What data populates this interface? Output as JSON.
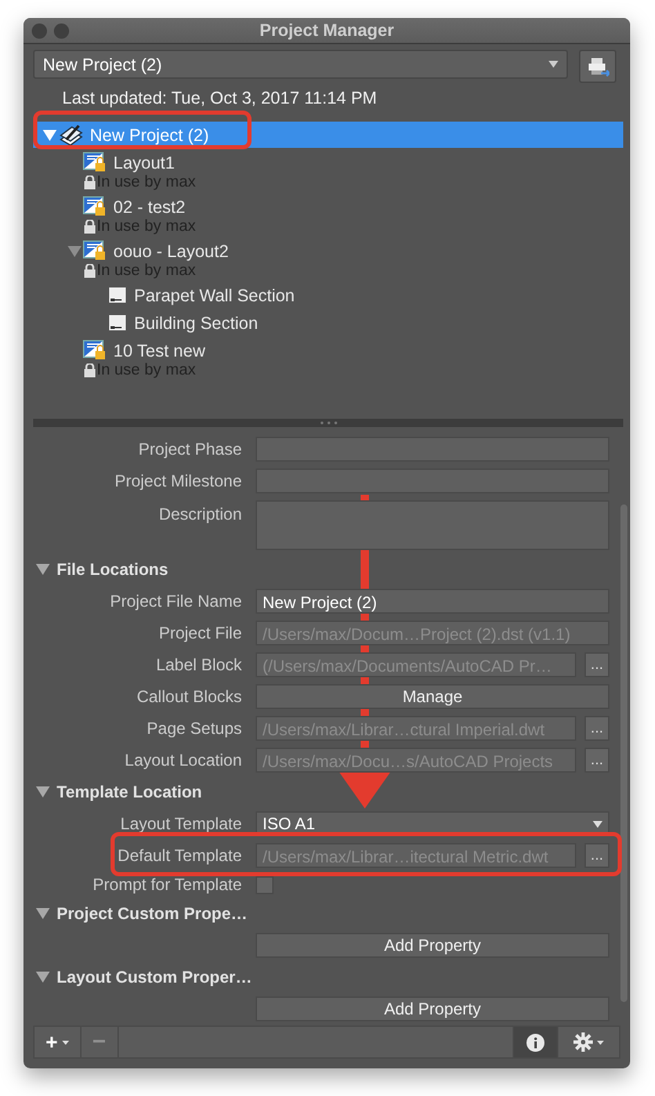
{
  "window": {
    "title": "Project Manager"
  },
  "project_select": {
    "value": "New Project (2)"
  },
  "last_updated": "Last updated: Tue, Oct 3, 2017 11:14 PM",
  "tree": [
    {
      "kind": "project",
      "label": "New Project (2)",
      "selected": true,
      "expanded": true,
      "children": [
        {
          "kind": "layout",
          "label": "Layout1",
          "status": "In use by max",
          "selected": false
        },
        {
          "kind": "layout",
          "label": "02 - test2",
          "status": "In use by max",
          "selected": false
        },
        {
          "kind": "layout",
          "label": "oouo - Layout2",
          "status": "In use by max",
          "selected": false,
          "expanded": true,
          "children": [
            {
              "kind": "view",
              "label": "Parapet Wall Section",
              "selected": false
            },
            {
              "kind": "view",
              "label": "Building Section",
              "selected": false
            }
          ]
        },
        {
          "kind": "layout",
          "label": "10 Test new",
          "status": "In use by max",
          "selected": false
        }
      ]
    }
  ],
  "properties": [
    {
      "kind": "field",
      "label": "Project Phase"
    },
    {
      "kind": "field",
      "label": "Project Milestone"
    },
    {
      "kind": "textarea",
      "label": "Description"
    },
    {
      "kind": "section",
      "label": "File Locations",
      "expanded": true
    },
    {
      "kind": "field",
      "label": "Project File Name",
      "value": "New Project (2)"
    },
    {
      "kind": "path",
      "label": "Project File",
      "value": "/Users/max/Docum…Project (2).dst (v1.1)"
    },
    {
      "kind": "browse",
      "label": "Label Block",
      "value": "(/Users/max/Documents/AutoCAD Pr…",
      "button": "..."
    },
    {
      "kind": "button",
      "label": "Callout Blocks",
      "button": "Manage"
    },
    {
      "kind": "browse",
      "label": "Page Setups",
      "value": "/Users/max/Librar…ctural Imperial.dwt",
      "button": "..."
    },
    {
      "kind": "browse",
      "label": "Layout Location",
      "value": "/Users/max/Docu…s/AutoCAD Projects",
      "button": "..."
    },
    {
      "kind": "section",
      "label": "Template Location",
      "expanded": true
    },
    {
      "kind": "dropdown",
      "label": "Layout Template",
      "value": "ISO A1"
    },
    {
      "kind": "browse",
      "label": "Default Template",
      "value": "/Users/max/Librar…itectural Metric.dwt",
      "button": "..."
    },
    {
      "kind": "checkbox",
      "label": "Prompt for Template",
      "checked": false
    },
    {
      "kind": "section",
      "label": "Project Custom Prope…",
      "expanded": true
    },
    {
      "kind": "button",
      "button": "Add Property"
    },
    {
      "kind": "section",
      "label": "Layout Custom Proper…",
      "expanded": true
    },
    {
      "kind": "button",
      "button": "Add Property"
    }
  ],
  "toolbar": {
    "add": "+",
    "remove": "−",
    "remove_disabled": true,
    "info_on": true
  }
}
